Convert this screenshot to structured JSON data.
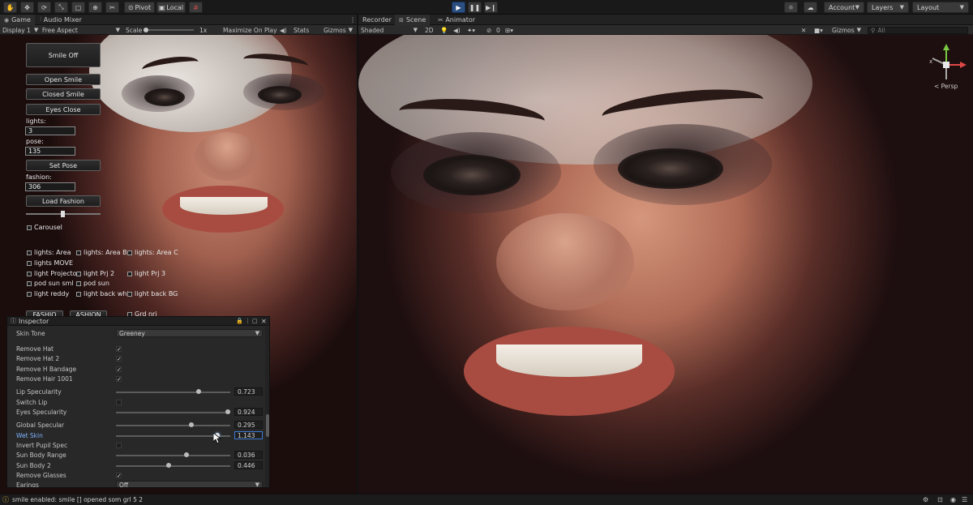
{
  "toolbar": {
    "pivot_label": "Pivot",
    "local_label": "Local",
    "account_label": "Account",
    "layers_label": "Layers",
    "layout_label": "Layout"
  },
  "game_panel": {
    "tabs": [
      "Game",
      "Audio Mixer"
    ],
    "display": "Display 1",
    "aspect": "Free Aspect",
    "scale_label": "Scale",
    "scale_value": "1x",
    "maximize_label": "Maximize On Play",
    "stats_label": "Stats",
    "gizmos_label": "Gizmos"
  },
  "scene_panel": {
    "tabs": [
      "Recorder",
      "Scene",
      "Animator"
    ],
    "shading": "Shaded",
    "mode_2d": "2D",
    "fx_count": "0",
    "gizmos_label": "Gizmos",
    "search_placeholder": "All",
    "persp_label": "< Persp"
  },
  "game_gui": {
    "smile_off": "Smile Off",
    "open_smile": "Open Smile",
    "closed_smile": "Closed Smile",
    "eyes_close": "Eyes Close",
    "lights_label": "lights:",
    "lights_value": "3",
    "pose_label": "pose:",
    "pose_value": "135",
    "set_pose": "Set Pose",
    "fashion_label": "fashion:",
    "fashion_value": "306",
    "load_fashion": "Load Fashion",
    "carousel": "Carousel",
    "checks": [
      "lights: Area",
      "lights: Area B",
      "lights: Area C",
      "lights MOVE",
      "light Projector",
      "light Prj 2",
      "light Prj 3",
      "pod sun sml",
      "pod sun",
      "light reddy",
      "light back wht",
      "light back BG"
    ],
    "partial_btn_1": "FASHIO",
    "partial_btn_2": "ASHION",
    "partial_check": "Grd nri"
  },
  "inspector": {
    "title": "Inspector",
    "skin_tone_label": "Skin Tone",
    "skin_tone_value": "Greeney",
    "toggles": [
      {
        "label": "Remove Hat",
        "checked": true
      },
      {
        "label": "Remove Hat 2",
        "checked": true
      },
      {
        "label": "Remove H Bandage",
        "checked": true
      },
      {
        "label": "Remove Hair 1001",
        "checked": true
      }
    ],
    "lip_specularity": {
      "label": "Lip Specularity",
      "value": "0.723",
      "fraction": 0.72
    },
    "switch_lip": {
      "label": "Switch Lip",
      "checked": false
    },
    "eyes_specularity": {
      "label": "Eyes Specularity",
      "value": "0.924",
      "fraction": 0.98
    },
    "global_specular": {
      "label": "Global Specular",
      "value": "0.295",
      "fraction": 0.66
    },
    "wet_skin": {
      "label": "Wet Skin",
      "value": "1.143",
      "fraction": 0.89
    },
    "invert_pupil": {
      "label": "Invert Pupil Spec",
      "checked": false
    },
    "sun_body_range": {
      "label": "Sun Body Range",
      "value": "0.036",
      "fraction": 0.62
    },
    "sun_body_2": {
      "label": "Sun Body 2",
      "value": "0.446",
      "fraction": 0.46
    },
    "remove_glasses": {
      "label": "Remove Glasses",
      "checked": true
    },
    "earings_label": "Earings",
    "earings_value": "Off"
  },
  "status": {
    "message": "smile enabled: smile [] opened som grl 5 2"
  }
}
